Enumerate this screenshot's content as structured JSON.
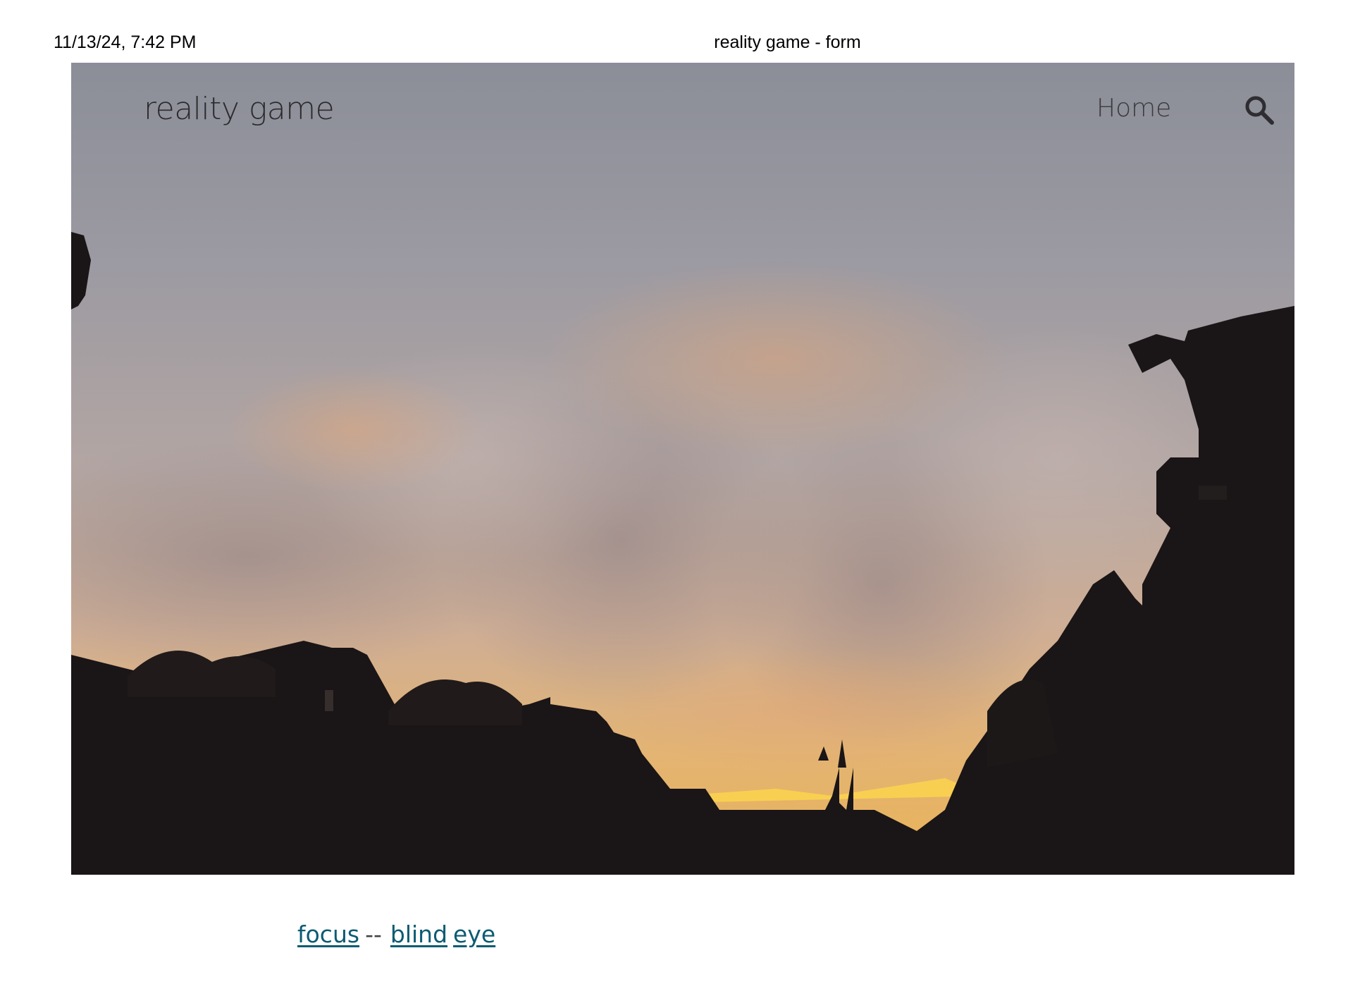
{
  "print_header": {
    "date": "11/13/24, 7:42 PM",
    "title": "reality game - form"
  },
  "site": {
    "title": "reality game",
    "nav": {
      "home_label": "Home"
    },
    "search_icon": "search-icon"
  },
  "hero_image": {
    "description_icon": "sunset-sky-photo"
  },
  "links": {
    "first": "focus",
    "separator": "--",
    "second": "blind",
    "third": "eye"
  },
  "colors": {
    "link": "#0b5b72",
    "sky_top": "#8a8e99",
    "sky_glow": "#f2c25a",
    "silhouette": "#161213"
  }
}
